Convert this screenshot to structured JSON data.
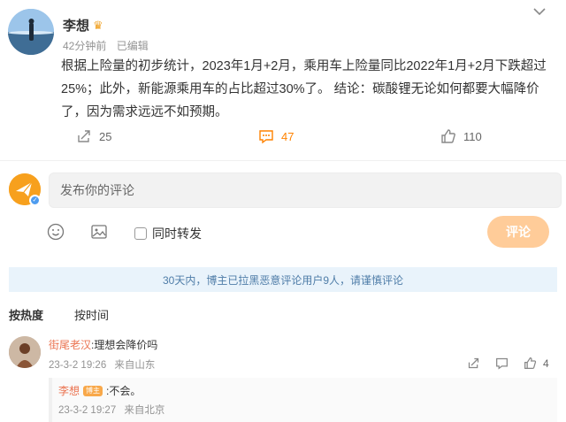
{
  "post": {
    "author": "李想",
    "author_badge_icon": "crown-icon",
    "time": "42分钟前",
    "edited": "已编辑",
    "text_lines": [
      "根据上险量的初步统计，2023年1月+2月，乘用车上险量同比2022年1月+2月下跌超过",
      "25%；此外，新能源乘用车的占比超过30%了。 结论：碳酸锂无论如何都要大幅降价",
      "了，因为需求远远不如预期。"
    ]
  },
  "actions": {
    "repost_count": "25",
    "comment_count": "47",
    "like_count": "110"
  },
  "composer": {
    "placeholder": "发布你的评论",
    "repost_label": "同时转发",
    "submit_label": "评论"
  },
  "notice": "30天内，博主已拉黑恶意评论用户9人，请谨慎评论",
  "sort_tabs": [
    "按热度",
    "按时间"
  ],
  "comment": {
    "user": "街尾老汉",
    "text": ":理想会降价吗",
    "date": "23-3-2 19:26",
    "location": "来自山东",
    "like_count": "4"
  },
  "reply": {
    "user": "李想",
    "badge": "博主",
    "text": ":不会。",
    "date": "23-3-2 19:27",
    "location": "来自北京"
  },
  "colors": {
    "accent_orange": "#ff8200",
    "username_orange": "#eb7350",
    "submit_disabled": "#ffcc99",
    "notice_bg": "#e9f3fb",
    "notice_text": "#4f7da8"
  }
}
